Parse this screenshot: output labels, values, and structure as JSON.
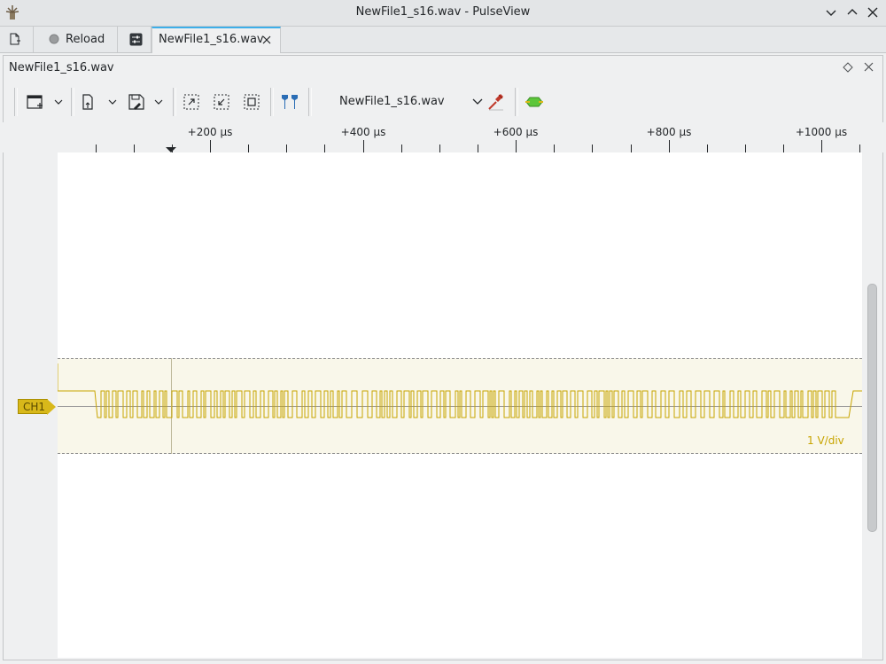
{
  "window": {
    "title": "NewFile1_s16.wav - PulseView"
  },
  "tabs": {
    "reload_label": "Reload",
    "session_tab_label": "NewFile1_s16.wav"
  },
  "panel": {
    "title": "NewFile1_s16.wav"
  },
  "toolbar": {
    "device_select_value": "NewFile1_s16.wav",
    "items": [
      "add-view",
      "open-file",
      "save-file",
      "zoom-fit",
      "zoom-one-to-one",
      "zoom-fit-to-cursors",
      "show-cursors",
      "device-select",
      "configure-probe",
      "decoders"
    ]
  },
  "ruler": {
    "ticks": [
      {
        "label": "+200 µs"
      },
      {
        "label": "+400 µs"
      },
      {
        "label": "+600 µs"
      },
      {
        "label": "+800 µs"
      },
      {
        "label": "+1000 µs"
      }
    ]
  },
  "channel": {
    "name": "CH1",
    "scale": "1 V/div",
    "color": "#c8a400"
  },
  "colors": {
    "accent": "#3daee9",
    "trace": "#c8a400",
    "trace_bg": "#f9f7ea"
  }
}
